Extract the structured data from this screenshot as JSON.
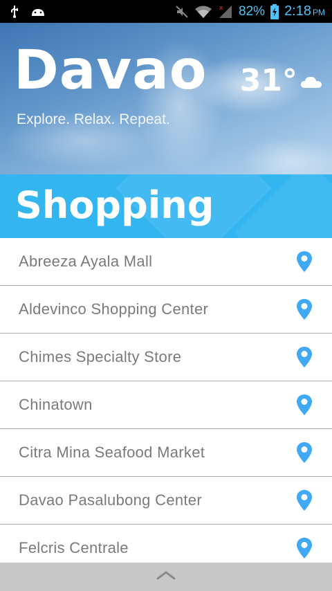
{
  "status_bar": {
    "battery_percent": "82%",
    "time": "2:18",
    "ampm": "PM",
    "icons": [
      "usb-icon",
      "android-icon",
      "mute-icon",
      "wifi-icon",
      "signal-icon",
      "battery-charging-icon"
    ]
  },
  "header": {
    "city": "Davao",
    "tagline": "Explore. Relax. Repeat.",
    "temperature": "31°",
    "weather_icon": "cloud-icon"
  },
  "category": {
    "title": "Shopping"
  },
  "places": [
    {
      "label": "Abreeza Ayala Mall"
    },
    {
      "label": "Aldevinco Shopping Center"
    },
    {
      "label": "Chimes Specialty Store"
    },
    {
      "label": "Chinatown"
    },
    {
      "label": "Citra Mina Seafood Market"
    },
    {
      "label": "Davao Pasalubong Center"
    },
    {
      "label": "Felcris Centrale"
    }
  ],
  "colors": {
    "accent": "#33b5f0",
    "pin": "#3fa9f5",
    "list_text": "#7a7a7a",
    "bottom_bar": "#c8c8c8"
  }
}
